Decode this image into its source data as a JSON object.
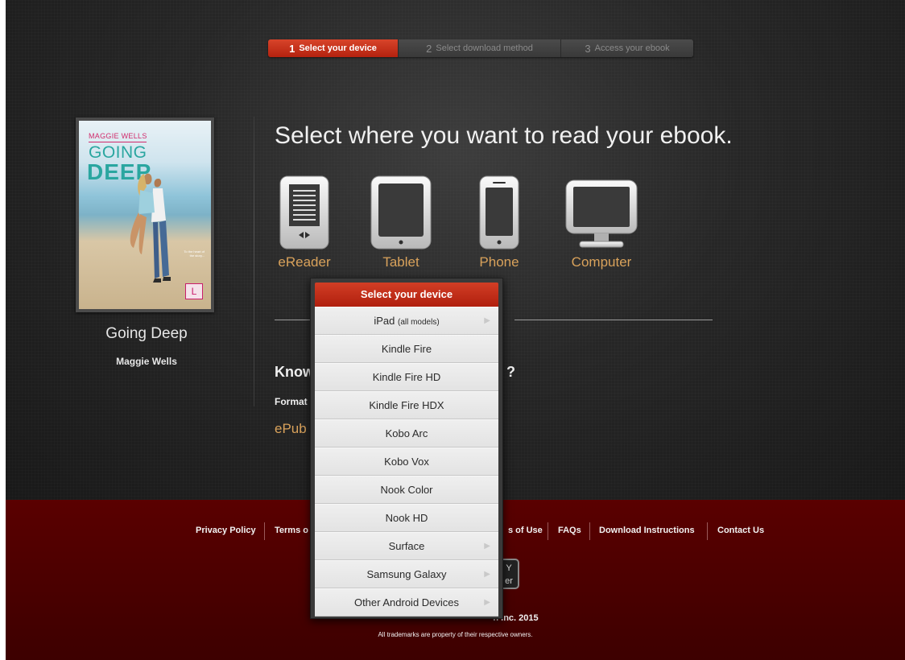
{
  "steps": [
    {
      "num": "1",
      "label": "Select your device",
      "active": true
    },
    {
      "num": "2",
      "label": "Select download method",
      "active": false
    },
    {
      "num": "3",
      "label": "Access your ebook",
      "active": false
    }
  ],
  "book": {
    "cover": {
      "author": "MAGGIE WELLS",
      "title_line1": "GOING",
      "title_line2": "DEEP",
      "tagline": "To the heart of the story..."
    },
    "title": "Going Deep",
    "author": "Maggie Wells"
  },
  "headline": "Select where you want to read your ebook.",
  "devices": [
    {
      "label": "eReader",
      "icon": "ereader-icon"
    },
    {
      "label": "Tablet",
      "icon": "tablet-icon"
    },
    {
      "label": "Phone",
      "icon": "phone-icon"
    },
    {
      "label": "Computer",
      "icon": "computer-icon"
    }
  ],
  "know": {
    "heading_start": "Know",
    "heading_end": "?",
    "format_label": "Format",
    "format_value": "ePub"
  },
  "dropdown": {
    "header": "Select your device",
    "items": [
      {
        "label": "iPad",
        "suffix": "(all models)",
        "submenu": true
      },
      {
        "label": "Kindle Fire",
        "submenu": false
      },
      {
        "label": "Kindle Fire HD",
        "submenu": false
      },
      {
        "label": "Kindle Fire HDX",
        "submenu": false
      },
      {
        "label": "Kobo Arc",
        "submenu": false
      },
      {
        "label": "Kobo Vox",
        "submenu": false
      },
      {
        "label": "Nook Color",
        "submenu": false
      },
      {
        "label": "Nook HD",
        "submenu": false
      },
      {
        "label": "Surface",
        "submenu": true
      },
      {
        "label": "Samsung Galaxy",
        "submenu": true
      },
      {
        "label": "Other Android Devices",
        "submenu": true
      }
    ]
  },
  "footer": {
    "links": {
      "privacy": "Privacy Policy",
      "terms_start": "Terms o",
      "terms_use_end": "s of Use",
      "faqs": "FAQs",
      "download_instructions": "Download Instructions",
      "contact": "Contact Us"
    },
    "badge": {
      "line1": "Y",
      "line2": "er"
    },
    "copyright": "n Inc. 2015",
    "trademarks": "All trademarks are property of their respective owners."
  },
  "colors": {
    "accent_red": "#c52f18",
    "link_gold": "#d9a25b",
    "footer_red": "#4c0000"
  }
}
